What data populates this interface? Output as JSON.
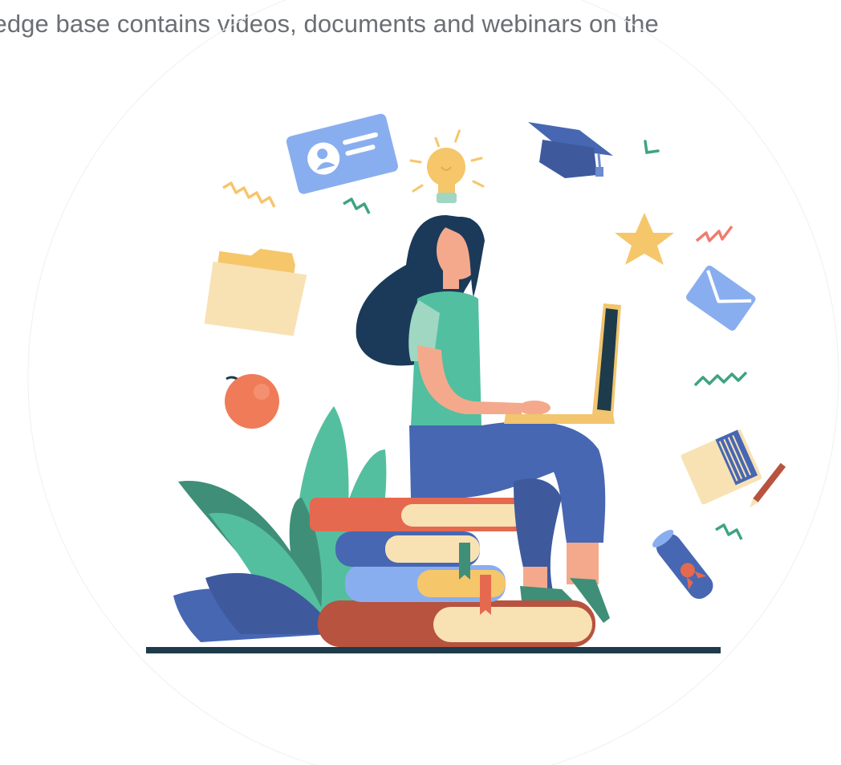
{
  "banner": {
    "caption": "wledge base contains videos, documents and webinars on the"
  },
  "illustration": {
    "subject": "woman-with-laptop-on-books",
    "icons": [
      "id-card-icon",
      "lightbulb-icon",
      "graduation-cap-icon",
      "folder-icon",
      "star-icon",
      "envelope-icon",
      "apple-icon",
      "notepad-icon",
      "pencil-icon",
      "diploma-scroll-icon"
    ],
    "colors": {
      "background": "#ffffff",
      "caption_text": "#6b6f74",
      "hair": "#1b3a5a",
      "shirt": "#52bfa1",
      "jeans": "#4767b3",
      "skin": "#f4a98c",
      "laptop_frame": "#f2c56e",
      "book_red": "#e5694f",
      "book_blue": "#4767b3",
      "book_light_blue": "#89aef0",
      "book_brown": "#b7533f",
      "pages": "#f8e2b4",
      "plant_dark": "#3f8f78",
      "plant_light": "#54bf9f",
      "ground": "#1d3b4a"
    }
  }
}
